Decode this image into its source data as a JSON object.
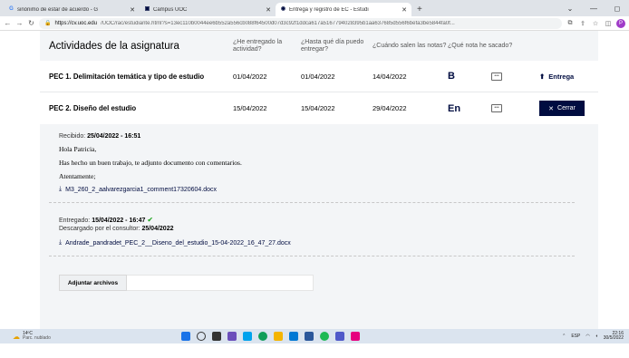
{
  "browser": {
    "tabs": [
      {
        "icon": "G",
        "icon_color": "#4285f4",
        "title": "sinónimo de estar de acuerdo - G",
        "close": "✕"
      },
      {
        "icon": "▣",
        "icon_color": "#000c40",
        "title": "Campus UOC",
        "close": "✕"
      },
      {
        "icon": "◉",
        "icon_color": "#000c40",
        "title": "Entrega y registro de EC - Estudi",
        "close": "✕"
      }
    ],
    "new_tab": "+",
    "window_controls": [
      "⌄",
      "—",
      "◻"
    ],
    "url_host": "https://cv.uoc.edu",
    "url_path": "/UOC/rac/estudiante.html?s=13ec110b0044ee6b552a556cb088f64500d07d3c92f1ddca617a5167794028395b1aa637685d556f6befa3be5844fa0f...",
    "profile_initial": "P"
  },
  "table": {
    "title": "Actividades de la asignatura",
    "columns": [
      "¿He entregado la actividad?",
      "¿Hasta qué día puedo entregar?",
      "¿Cuándo salen las notas?",
      "¿Qué nota he sacado?"
    ],
    "rows": [
      {
        "name": "PEC 1. Delimitación temática y tipo de estudio",
        "delivered": "01/04/2022",
        "deadline": "01/04/2022",
        "grades_date": "14/04/2022",
        "grade": "B",
        "action": "Entrega",
        "action_icon": "⬆"
      },
      {
        "name": "PEC 2. Diseño del estudio",
        "delivered": "15/04/2022",
        "deadline": "15/04/2022",
        "grades_date": "29/04/2022",
        "grade": "En",
        "action": "Cerrar",
        "action_icon": "✕"
      }
    ]
  },
  "detail": {
    "received_label": "Recibido:",
    "received_value": "25/04/2022 - 16:51",
    "greeting": "Hola Patricia,",
    "message": "Has hecho un buen trabajo, te adjunto documento con comentarios.",
    "closing": "Atentamente;",
    "feedback_file": "M3_260_2_aalvarezgarcia1_comment17320604.docx",
    "delivered_label": "Entregado:",
    "delivered_value": "15/04/2022 - 16:47",
    "downloaded_label": "Descargado por el consultor:",
    "downloaded_value": "25/04/2022",
    "submitted_file": "Andrade_pandradet_PEC_2__Diseno_del_estudio_15-04-2022_16_47_27.docx",
    "attach_button": "Adjuntar archivos"
  },
  "taskbar": {
    "temperature": "14ºC",
    "weather": "Parc. nublado",
    "language": "ESP",
    "time": "22:16",
    "date": "30/5/2022"
  }
}
